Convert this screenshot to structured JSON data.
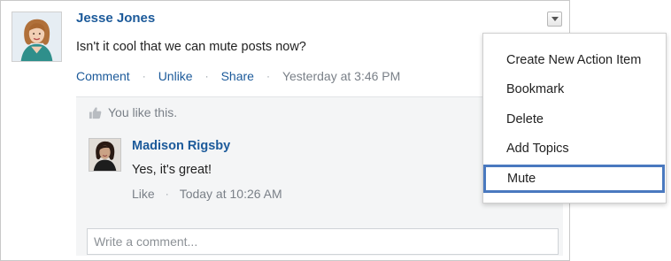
{
  "post": {
    "author": "Jesse Jones",
    "text": "Isn't it cool that we can mute posts now?",
    "actions": {
      "comment": "Comment",
      "unlike": "Unlike",
      "share": "Share",
      "separator": "·",
      "timestamp": "Yesterday at 3:46 PM"
    }
  },
  "likes": {
    "text": "You like this."
  },
  "comment": {
    "author": "Madison Rigsby",
    "text": "Yes, it's great!",
    "like": "Like",
    "separator": "·",
    "timestamp": "Today at 10:26 AM"
  },
  "comment_input": {
    "placeholder": "Write a comment..."
  },
  "menu": {
    "items": [
      "Create New Action Item",
      "Bookmark",
      "Delete",
      "Add Topics",
      "Mute"
    ],
    "highlighted": "Mute"
  },
  "colors": {
    "link": "#1c5a9a",
    "highlight_border": "#4a79bf",
    "comments_background": "#f4f5f6"
  }
}
